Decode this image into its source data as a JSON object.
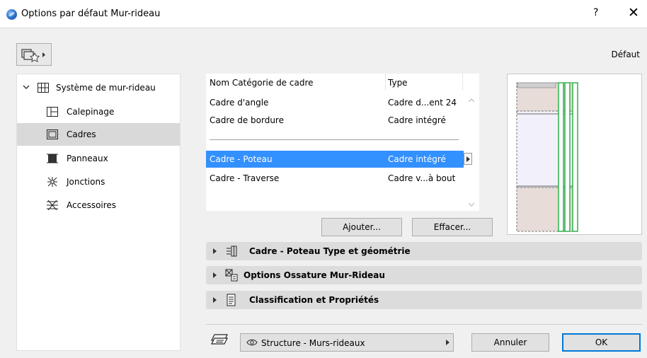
{
  "window": {
    "title": "Options par défaut Mur-rideau",
    "help": "?",
    "close": "✕"
  },
  "toolbar": {
    "favorites_icon": "favorites-icon",
    "preset_label": "Défaut"
  },
  "tree": {
    "root": {
      "label": "Système de mur-rideau",
      "icon": "grid-icon"
    },
    "items": [
      {
        "label": "Calepinage",
        "icon": "layout-icon"
      },
      {
        "label": "Cadres",
        "icon": "frame-icon",
        "selected": true
      },
      {
        "label": "Panneaux",
        "icon": "panel-icon"
      },
      {
        "label": "Jonctions",
        "icon": "junction-icon"
      },
      {
        "label": "Accessoires",
        "icon": "accessory-icon"
      }
    ]
  },
  "frame_list": {
    "headers": [
      "Nom Catégorie de cadre",
      "Type"
    ],
    "rows": [
      {
        "name": "Cadre d'angle",
        "type": "Cadre d...ent 24"
      },
      {
        "name": "Cadre de bordure",
        "type": "Cadre intégré"
      },
      {
        "name": "Cadre - Poteau",
        "type": "Cadre intégré",
        "selected": true
      },
      {
        "name": "Cadre - Traverse",
        "type": "Cadre v...à bout"
      }
    ],
    "add_label": "Ajouter...",
    "delete_label": "Effacer..."
  },
  "sections": [
    {
      "label": "Cadre - Poteau Type et géométrie",
      "icon": "frame-geometry-icon"
    },
    {
      "label": "Options Ossature Mur-Rideau",
      "icon": "framework-options-icon"
    },
    {
      "label": "Classification et Propriétés",
      "icon": "document-icon"
    }
  ],
  "footer": {
    "layer_label": "Structure - Murs-rideaux",
    "cancel_label": "Annuler",
    "ok_label": "OK"
  },
  "colors": {
    "selection": "#3390ff",
    "accent": "#0078d7",
    "preview_frame": "#2fb34a"
  }
}
